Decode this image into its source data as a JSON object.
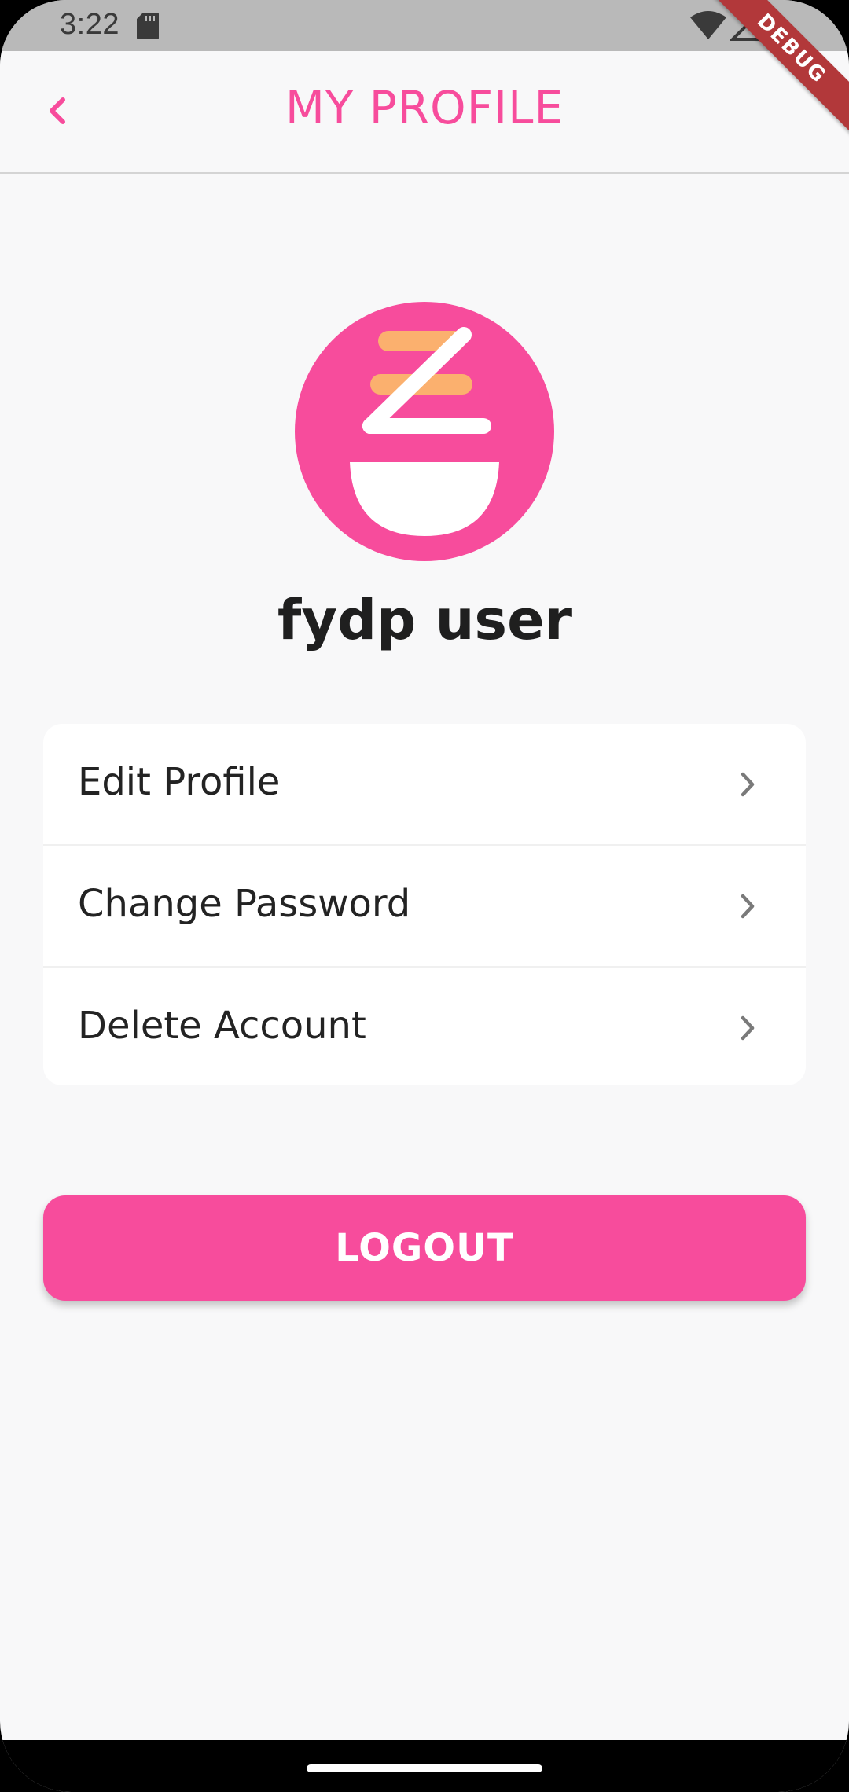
{
  "status_bar": {
    "time": "3:22",
    "icons": [
      "sd-card-icon",
      "wifi-icon",
      "signal-icon"
    ]
  },
  "debug_banner": "DEBUG",
  "app_bar": {
    "title": "MY PROFILE",
    "back_icon": "chevron-left-icon"
  },
  "profile": {
    "avatar_icon": "bowl-chopsticks-logo",
    "name": "fydp user"
  },
  "menu": {
    "items": [
      {
        "label": "Edit Profile",
        "icon": "chevron-right-icon"
      },
      {
        "label": "Change Password",
        "icon": "chevron-right-icon"
      },
      {
        "label": "Delete Account",
        "icon": "chevron-right-icon"
      }
    ]
  },
  "logout": {
    "label": "LOGOUT"
  },
  "colors": {
    "accent": "#f74c9c",
    "logo_stripes": "#fbb06e",
    "background": "#f8f8f9",
    "status_bar": "#b9b9b9",
    "debug_banner": "#b2383a"
  }
}
